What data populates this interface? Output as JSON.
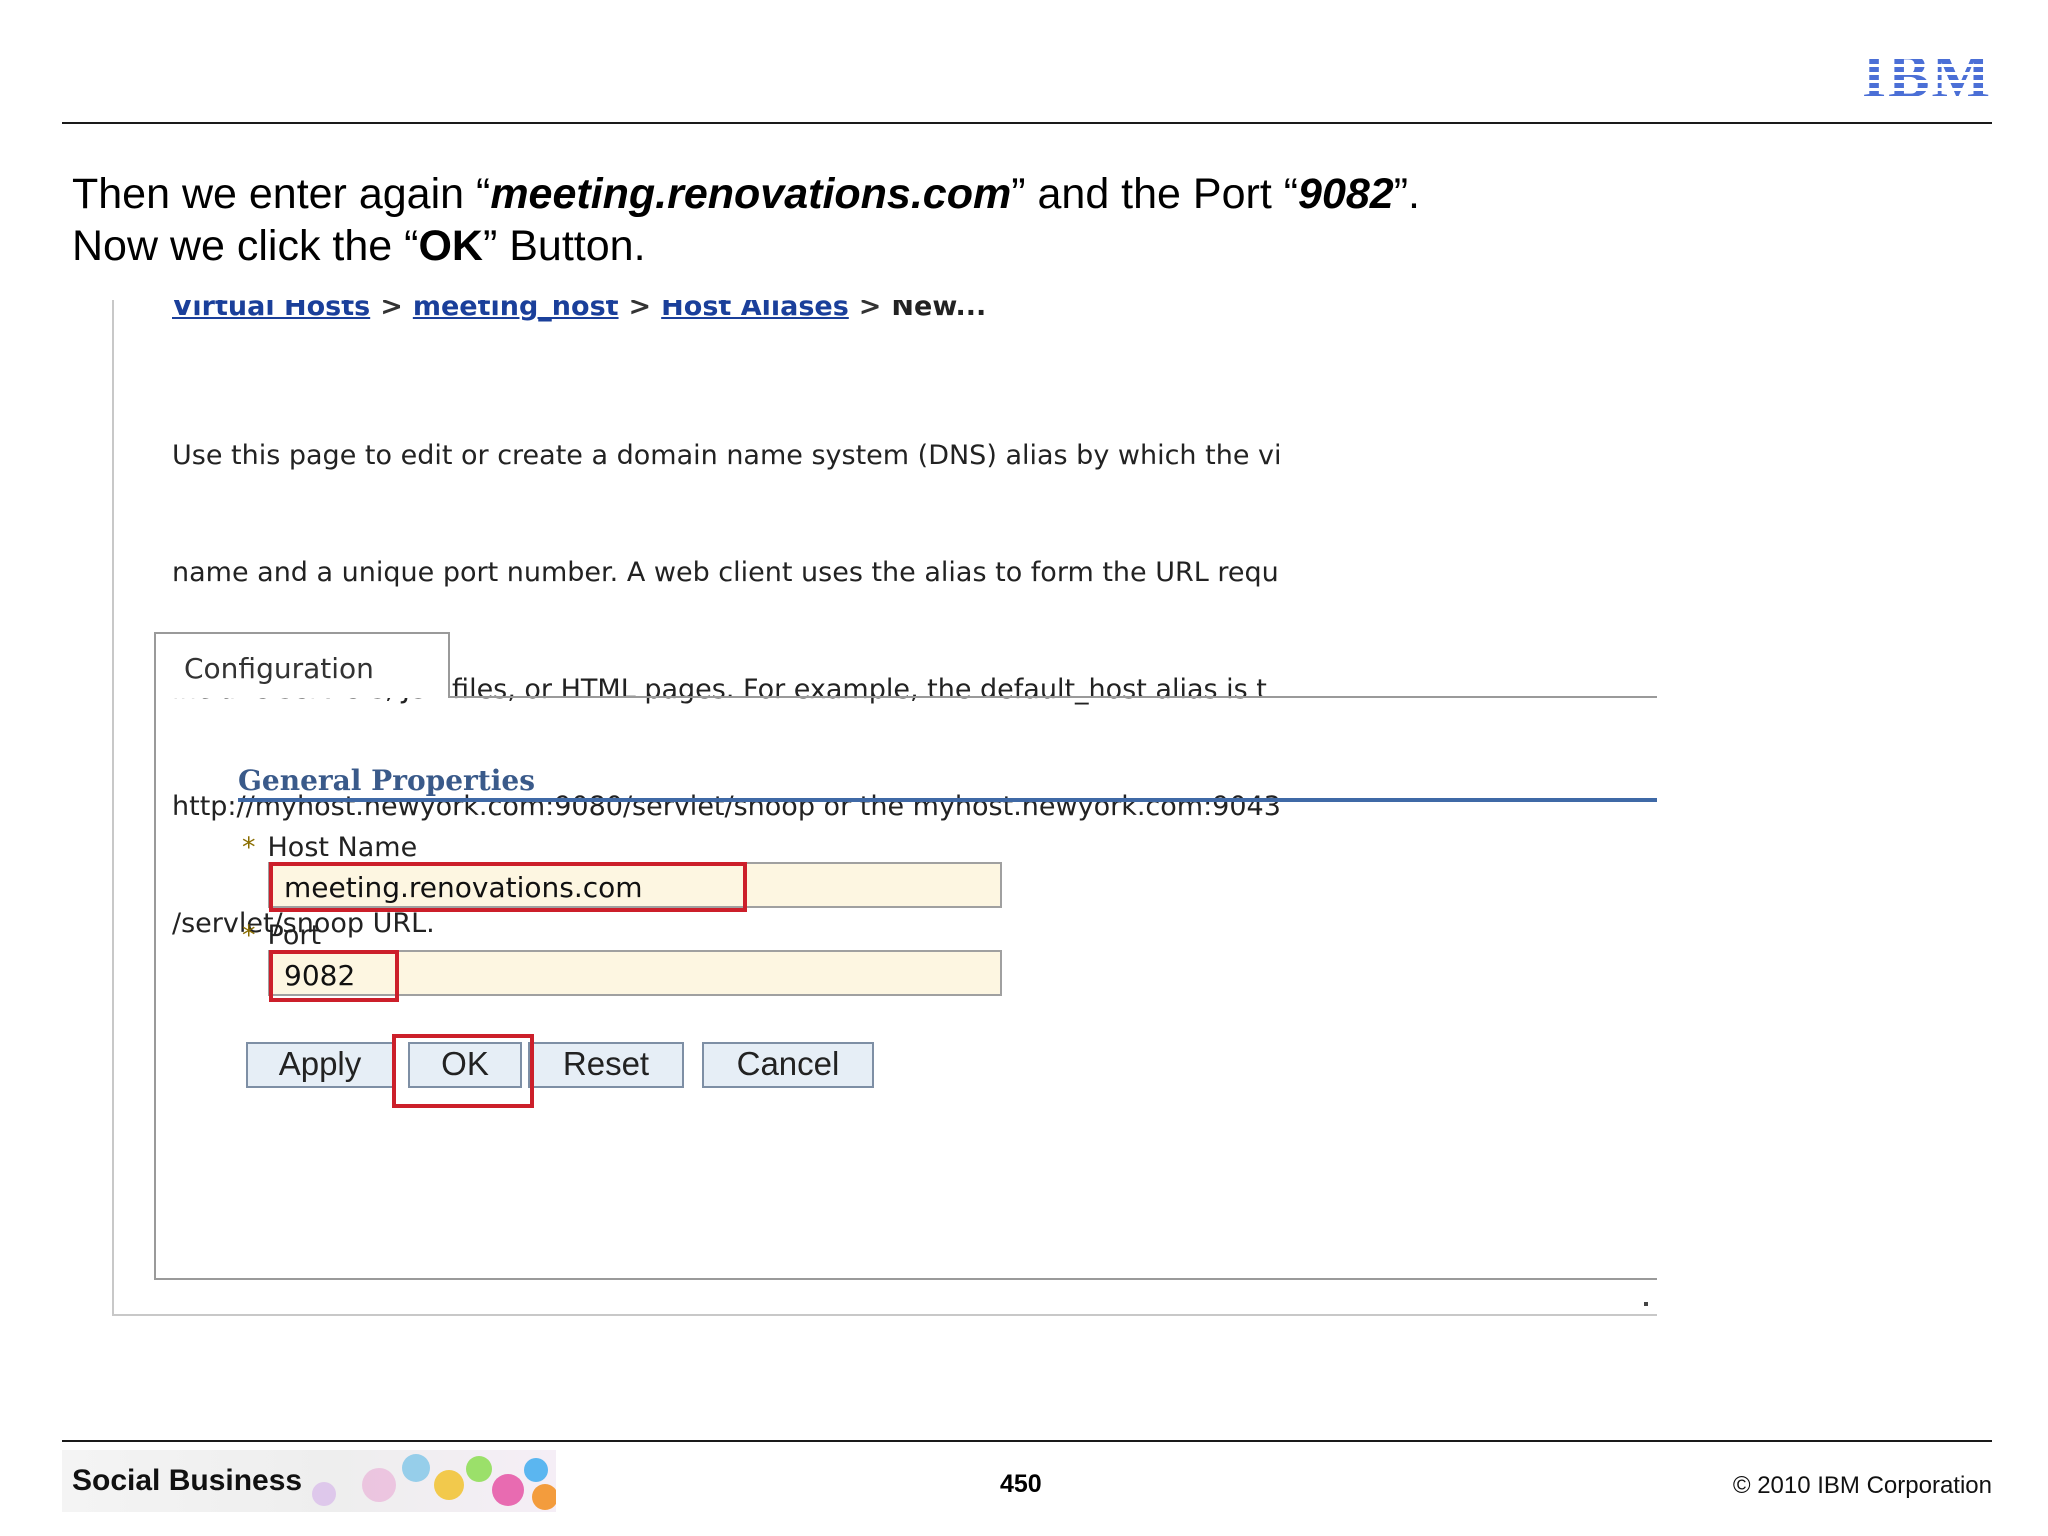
{
  "slide": {
    "logo_text": "IBM",
    "instructions": {
      "line1_prefix": "Then we enter again “",
      "line1_host": "meeting.renovations.com",
      "line1_mid": "” and the Port “",
      "line1_port": "9082",
      "line1_suffix": "”.",
      "line2_prefix": "Now we click the “",
      "line2_ok": "OK",
      "line2_suffix": "” Button."
    }
  },
  "console": {
    "breadcrumb": {
      "items": [
        "Virtual Hosts",
        "meeting_host",
        "Host Aliases"
      ],
      "separator": ">",
      "current": "New..."
    },
    "description_lines": [
      "Use this page to edit or create a domain name system (DNS) alias by which the vi",
      "name and a unique port number. A web client uses the alias to form the URL requ",
      "include servlets, JSP files, or HTML pages. For example, the default_host alias is t",
      "http://myhost.newyork.com:9080/servlet/snoop or the myhost.newyork.com:9043",
      "/servlet/snoop URL."
    ],
    "tab_label": "Configuration",
    "section_title": "General Properties",
    "required_marker": "*",
    "host_name_label": "Host Name",
    "host_name_value": "meeting.renovations.com",
    "port_label": "Port",
    "port_value": "9082",
    "buttons": {
      "apply": "Apply",
      "ok": "OK",
      "reset": "Reset",
      "cancel": "Cancel"
    },
    "colors": {
      "highlight": "#cc1f2a",
      "input_background": "#fdf6e1",
      "section_rule": "#3f69a6",
      "link": "#1a3f9a"
    }
  },
  "footer": {
    "brand_label": "Social Business",
    "page_number": "450",
    "copyright": "© 2010 IBM Corporation"
  }
}
